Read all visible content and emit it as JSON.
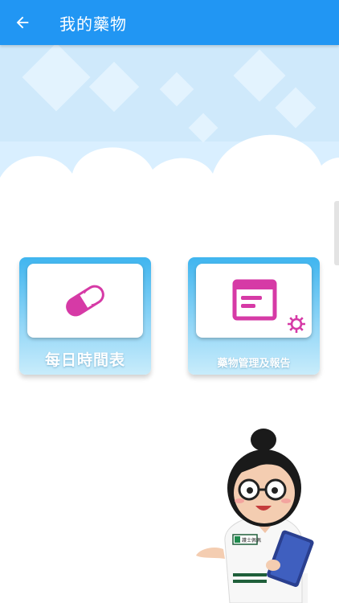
{
  "app_bar": {
    "title": "我的藥物",
    "back_icon": "arrow-left-icon"
  },
  "cards": [
    {
      "label": "每日時間表",
      "icon": "pill-icon",
      "icon_color": "#d63aa6"
    },
    {
      "label": "藥物管理及報告",
      "icon": "document-settings-icon",
      "icon_color": "#d63aa6"
    }
  ],
  "nurse": {
    "badge_text": "護士佩佩"
  },
  "colors": {
    "app_bar": "#2196f3",
    "card_gradient_top": "#3fb5ef",
    "sky": "#d9efff",
    "icon": "#d63aa6"
  }
}
